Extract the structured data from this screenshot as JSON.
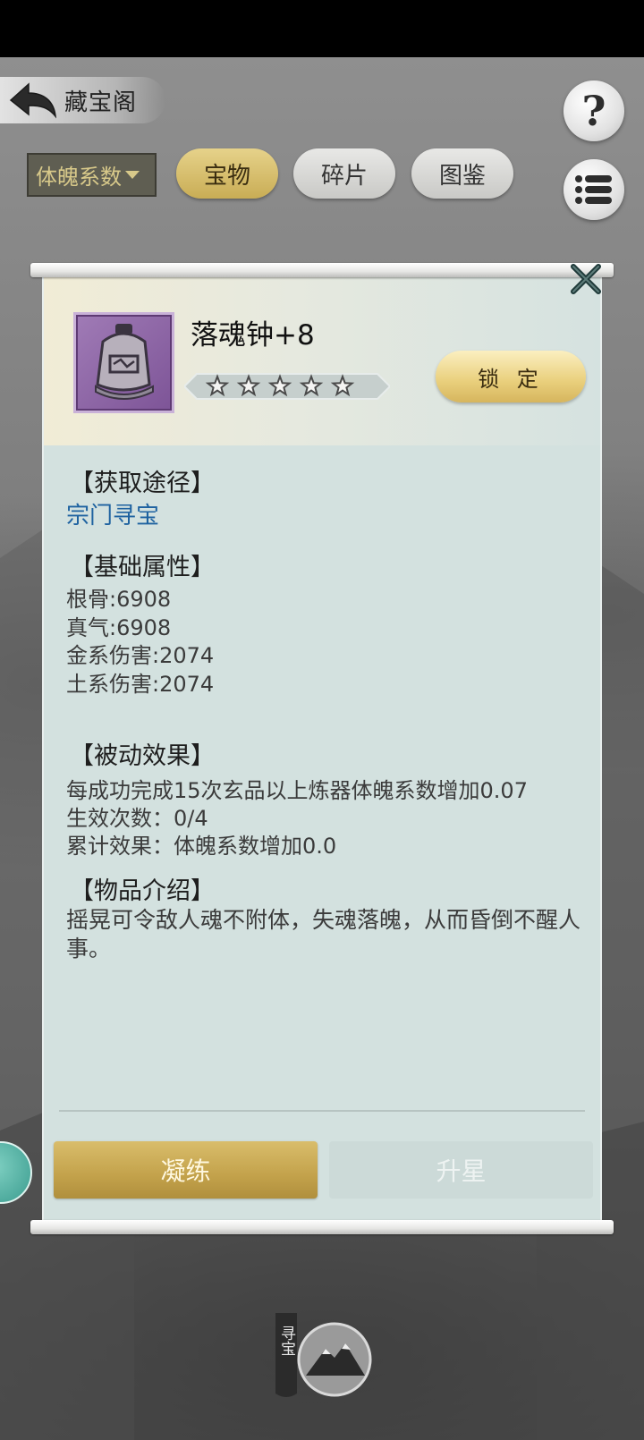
{
  "header": {
    "title": "藏宝阁",
    "help_glyph": "?"
  },
  "filter": {
    "selected": "体魄系数"
  },
  "tabs": [
    {
      "label": "宝物",
      "active": true
    },
    {
      "label": "碎片",
      "active": false
    },
    {
      "label": "图鉴",
      "active": false
    }
  ],
  "item": {
    "name": "落魂钟+8",
    "stars": 5,
    "lock_label": "锁 定"
  },
  "sections": {
    "acquire_title": "【获取途径】",
    "acquire_link": "宗门寻宝",
    "base_title": "【基础属性】",
    "base_attrs": [
      "根骨:6908",
      "真气:6908",
      "金系伤害:2074",
      "土系伤害:2074"
    ],
    "passive_title": "【被动效果】",
    "passive_lines": [
      "每成功完成15次玄品以上炼器体魄系数增加0.07",
      "生效次数：0/4",
      "累计效果：体魄系数增加0.0"
    ],
    "intro_title": "【物品介绍】",
    "intro_text": "摇晃可令敌人魂不附体，失魂落魄，从而昏倒不醒人事。"
  },
  "actions": {
    "refine_label": "凝练",
    "upstar_label": "升星"
  },
  "bottom": {
    "treasure_hunt_label": "寻宝"
  },
  "colors": {
    "gold_button": "#c9ad55",
    "link_blue": "#1e62a0",
    "panel_bg": "#d3e1df",
    "item_frame": "#8b62a3"
  }
}
